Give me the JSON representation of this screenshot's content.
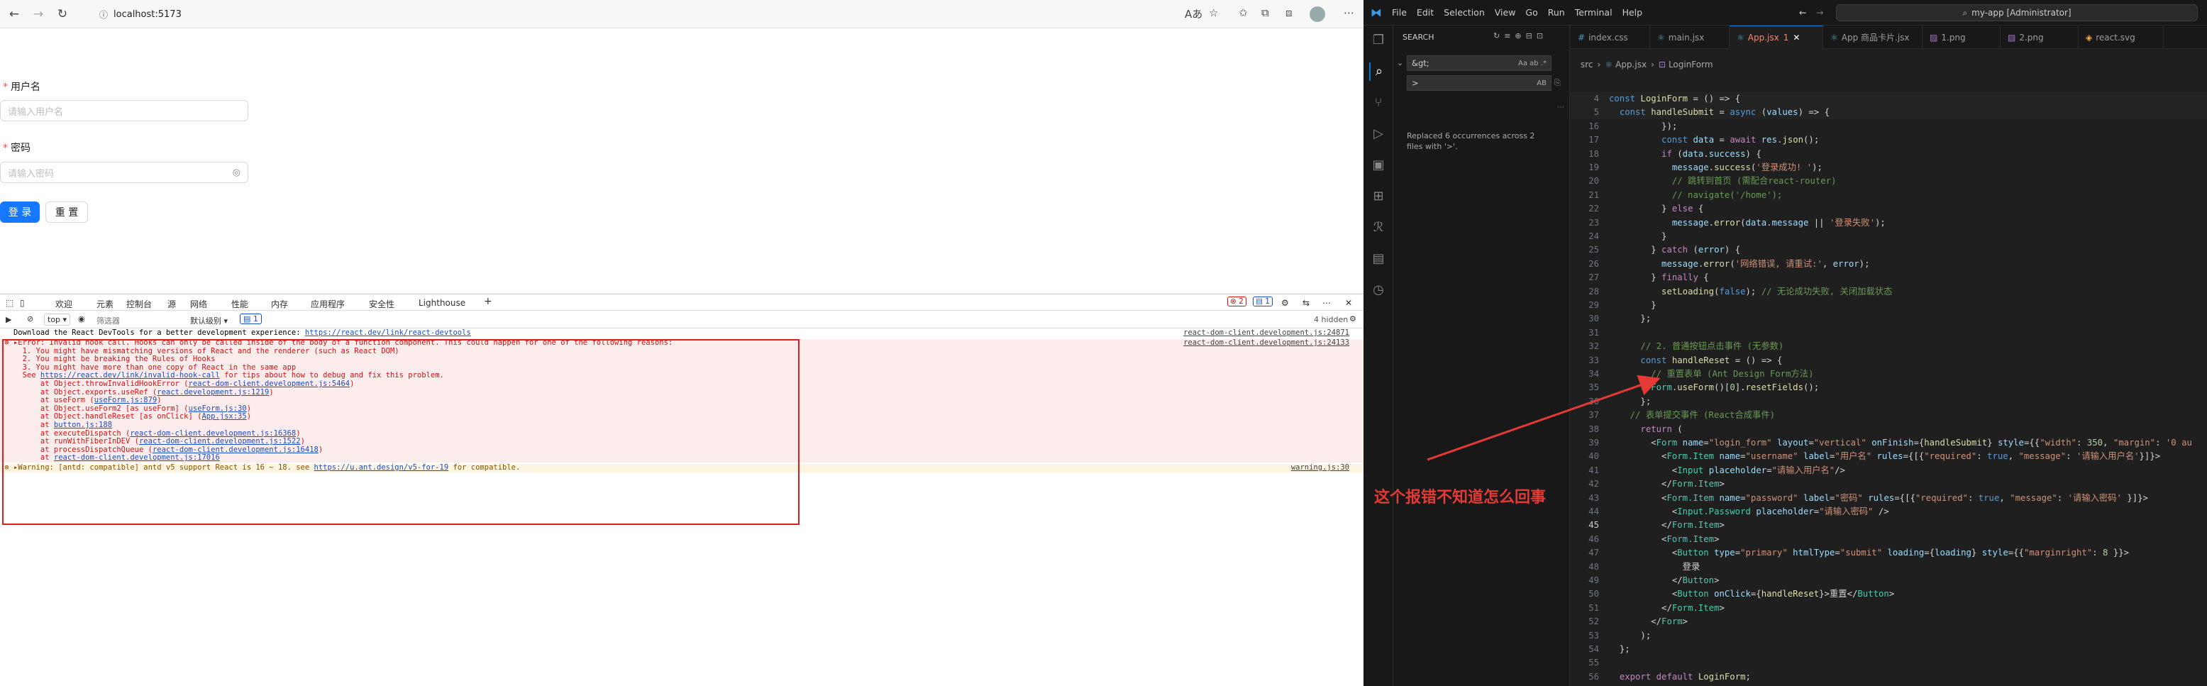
{
  "browser": {
    "url": "localhost:5173",
    "form": {
      "username_label": "用户名",
      "username_placeholder": "请输入用户名",
      "password_label": "密码",
      "password_placeholder": "请输入密码",
      "login_button": "登 录",
      "reset_button": "重 置"
    },
    "devtools": {
      "tabs": [
        "欢迎",
        "元素",
        "控制台",
        "源",
        "网络",
        "性能",
        "内存",
        "应用程序",
        "安全性",
        "Lighthouse"
      ],
      "active_tab": "控制台",
      "error_count": "2",
      "info_count": "1",
      "context": "top",
      "filter_placeholder": "筛选器",
      "level": "默认级别",
      "issue_count": "1",
      "hidden": "4 hidden",
      "console": [
        {
          "type": "info",
          "text": "Download the React DevTools for a better development experience: ",
          "link": "https://react.dev/link/react-devtools",
          "source": "react-dom-client.development.js:24871"
        },
        {
          "type": "error",
          "text": "▸Error: Invalid hook call. Hooks can only be called inside of the body of a function component. This could happen for one of the following reasons:",
          "source": "react-dom-client.development.js:24133"
        },
        {
          "type": "error-cont",
          "text": "1. You might have mismatching versions of React and the renderer (such as React DOM)"
        },
        {
          "type": "error-cont",
          "text": "2. You might be breaking the Rules of Hooks"
        },
        {
          "type": "error-cont",
          "text": "3. You might have more than one copy of React in the same app"
        },
        {
          "type": "error-cont",
          "text": "See ",
          "link": "https://react.dev/link/invalid-hook-call",
          "tail": " for tips about how to debug and fix this problem."
        },
        {
          "type": "stack",
          "text": "    at Object.throwInvalidHookError (",
          "link": "react-dom-client.development.js:5464",
          "tail": ")"
        },
        {
          "type": "stack",
          "text": "    at Object.exports.useRef (",
          "link": "react.development.js:1219",
          "tail": ")"
        },
        {
          "type": "stack",
          "text": "    at useForm (",
          "link": "useForm.js:879",
          "tail": ")"
        },
        {
          "type": "stack",
          "text": "    at Object.useForm2 [as useForm] (",
          "link": "useForm.js:30",
          "tail": ")"
        },
        {
          "type": "stack",
          "text": "    at Object.handleReset [as onClick] (",
          "link": "App.jsx:35",
          "tail": ")"
        },
        {
          "type": "stack",
          "text": "    at ",
          "link": "button.js:188",
          "tail": ""
        },
        {
          "type": "stack",
          "text": "    at executeDispatch (",
          "link": "react-dom-client.development.js:16368",
          "tail": ")"
        },
        {
          "type": "stack",
          "text": "    at runWithFiberInDEV (",
          "link": "react-dom-client.development.js:1522",
          "tail": ")"
        },
        {
          "type": "stack",
          "text": "    at processDispatchQueue (",
          "link": "react-dom-client.development.js:16418",
          "tail": ")"
        },
        {
          "type": "stack",
          "text": "    at ",
          "link": "react-dom-client.development.js:17016",
          "tail": ""
        },
        {
          "type": "warn",
          "text": "▸Warning: [antd: compatible] antd v5 support React is 16 ~ 18. see ",
          "link": "https://u.ant.design/v5-for-19",
          "tail": " for compatible.",
          "source": "warning.js:30"
        }
      ]
    }
  },
  "vscode": {
    "menus": [
      "File",
      "Edit",
      "Selection",
      "View",
      "Go",
      "Run",
      "Terminal",
      "Help"
    ],
    "command_center": "my-app [Administrator]",
    "search": {
      "title": "SEARCH",
      "find": "&gt;",
      "replace": ">",
      "result": "Replaced 6 occurrences across 2 files with '>'."
    },
    "tabs": [
      {
        "label": "index.css",
        "active": false
      },
      {
        "label": "main.jsx",
        "active": false
      },
      {
        "label": "App.jsx",
        "badge": "1",
        "active": true
      },
      {
        "label": "App 商品卡片.jsx",
        "active": false
      },
      {
        "label": "1.png",
        "active": false
      },
      {
        "label": "2.png",
        "active": false
      },
      {
        "label": "react.svg",
        "active": false
      }
    ],
    "breadcrumb": [
      "src",
      "App.jsx",
      "LoginForm"
    ],
    "code": [
      {
        "n": "4",
        "html": "<span class='kb'>const</span> <span class='f'>LoginForm</span> <span class='p'>= () =&gt; {</span>"
      },
      {
        "n": "5",
        "html": "  <span class='kb'>const</span> <span class='f'>handleSubmit</span> <span class='p'>=</span> <span class='kb'>async</span> <span class='p'>(</span><span class='v'>values</span><span class='p'>) =&gt; {</span>"
      },
      {
        "n": "16",
        "html": "          <span class='p'>});</span>"
      },
      {
        "n": "17",
        "html": "          <span class='kb'>const</span> <span class='v'>data</span> <span class='p'>=</span> <span class='k'>await</span> <span class='v'>res</span>.<span class='f'>json</span><span class='p'>();</span>"
      },
      {
        "n": "18",
        "html": "          <span class='k'>if</span> <span class='p'>(</span><span class='v'>data</span>.<span class='v'>success</span><span class='p'>) {</span>"
      },
      {
        "n": "19",
        "html": "            <span class='v'>message</span>.<span class='f'>success</span><span class='p'>(</span><span class='s'>'登录成功! '</span><span class='p'>);</span>"
      },
      {
        "n": "20",
        "html": "            <span class='c'>// 跳转到首页 (需配合react-router)</span>"
      },
      {
        "n": "21",
        "html": "            <span class='c'>// navigate('/home');</span>"
      },
      {
        "n": "22",
        "html": "          <span class='p'>}</span> <span class='k'>else</span> <span class='p'>{</span>"
      },
      {
        "n": "23",
        "html": "            <span class='v'>message</span>.<span class='f'>error</span><span class='p'>(</span><span class='v'>data</span>.<span class='v'>message</span> <span class='p'>||</span> <span class='s'>'登录失败'</span><span class='p'>);</span>"
      },
      {
        "n": "24",
        "html": "          <span class='p'>}</span>"
      },
      {
        "n": "25",
        "html": "        <span class='p'>}</span> <span class='k'>catch</span> <span class='p'>(</span><span class='v'>error</span><span class='p'>) {</span>"
      },
      {
        "n": "26",
        "html": "          <span class='v'>message</span>.<span class='f'>error</span><span class='p'>(</span><span class='s'>'网络错误, 请重试:'</span><span class='p'>,</span> <span class='v'>error</span><span class='p'>);</span>"
      },
      {
        "n": "27",
        "html": "        <span class='p'>}</span> <span class='k'>finally</span> <span class='p'>{</span>"
      },
      {
        "n": "28",
        "html": "          <span class='f'>setLoading</span><span class='p'>(</span><span class='kb'>false</span><span class='p'>);</span> <span class='c'>// 无论成功失败, 关闭加载状态</span>"
      },
      {
        "n": "29",
        "html": "        <span class='p'>}</span>"
      },
      {
        "n": "30",
        "html": "      <span class='p'>};</span>"
      },
      {
        "n": "31",
        "html": ""
      },
      {
        "n": "32",
        "html": "      <span class='c'>// 2. 普通按钮点击事件 (无参数)</span>"
      },
      {
        "n": "33",
        "html": "      <span class='kb'>const</span> <span class='f'>handleReset</span> <span class='p'>= () =&gt; {</span>"
      },
      {
        "n": "34",
        "html": "        <span class='c'>// 重置表单 (Ant Design Form方法)</span>"
      },
      {
        "n": "35",
        "html": "        <span class='t'>Form</span>.<span class='f'>useForm</span><span class='p'>()[</span><span class='n'>0</span><span class='p'>].</span><span class='f'>resetFields</span><span class='p'>();</span>"
      },
      {
        "n": "36",
        "html": "      <span class='p'>};</span>"
      },
      {
        "n": "37",
        "html": "    <span class='c'>// 表单提交事件 (React合成事件)</span>"
      },
      {
        "n": "38",
        "html": "      <span class='k'>return</span> <span class='p'>(</span>"
      },
      {
        "n": "39",
        "html": "        <span class='p'>&lt;</span><span class='t'>Form</span> <span class='v'>name</span><span class='p'>=</span><span class='s'>\"login_form\"</span> <span class='v'>layout</span><span class='p'>=</span><span class='s'>\"vertical\"</span> <span class='v'>onFinish</span><span class='p'>={</span><span class='f'>handleSubmit</span><span class='p'>}</span> <span class='v'>style</span><span class='p'>={{</span><span class='s'>\"width\"</span><span class='p'>:</span> <span class='n'>350</span><span class='p'>,</span> <span class='s'>\"margin\"</span><span class='p'>:</span> <span class='s'>'0 au</span>"
      },
      {
        "n": "40",
        "html": "          <span class='p'>&lt;</span><span class='t'>Form.Item</span> <span class='v'>name</span><span class='p'>=</span><span class='s'>\"username\"</span> <span class='v'>label</span><span class='p'>=</span><span class='s'>\"用户名\"</span> <span class='v'>rules</span><span class='p'>={[{</span><span class='s'>\"required\"</span><span class='p'>:</span> <span class='kb'>true</span><span class='p'>,</span> <span class='s'>\"message\"</span><span class='p'>:</span> <span class='s'>'请输入用户名'</span><span class='p'>}]}&gt;</span>"
      },
      {
        "n": "41",
        "html": "            <span class='p'>&lt;</span><span class='t'>Input</span> <span class='v'>placeholder</span><span class='p'>=</span><span class='s'>\"请输入用户名\"</span><span class='p'>/&gt;</span>"
      },
      {
        "n": "42",
        "html": "          <span class='p'>&lt;/</span><span class='t'>Form.Item</span><span class='p'>&gt;</span>"
      },
      {
        "n": "43",
        "html": "          <span class='p'>&lt;</span><span class='t'>Form.Item</span> <span class='v'>name</span><span class='p'>=</span><span class='s'>\"password\"</span> <span class='v'>label</span><span class='p'>=</span><span class='s'>\"密码\"</span> <span class='v'>rules</span><span class='p'>={[{</span><span class='s'>\"required\"</span><span class='p'>:</span> <span class='kb'>true</span><span class='p'>,</span> <span class='s'>\"message\"</span><span class='p'>:</span> <span class='s'>'请输入密码'</span> <span class='p'>}]}&gt;</span>"
      },
      {
        "n": "44",
        "html": "            <span class='p'>&lt;</span><span class='t'>Input.Password</span> <span class='v'>placeholder</span><span class='p'>=</span><span class='s'>\"请输入密码\"</span> <span class='p'>/&gt;</span>"
      },
      {
        "n": "45",
        "html": "          <span class='p'>&lt;/</span><span class='t'>Form.Item</span><span class='p'>&gt;</span>"
      },
      {
        "n": "46",
        "html": "          <span class='p'>&lt;</span><span class='t'>Form.Item</span><span class='p'>&gt;</span>"
      },
      {
        "n": "47",
        "html": "            <span class='p'>&lt;</span><span class='t'>Button</span> <span class='v'>type</span><span class='p'>=</span><span class='s'>\"primary\"</span> <span class='v'>htmlType</span><span class='p'>=</span><span class='s'>\"submit\"</span> <span class='v'>loading</span><span class='p'>={</span><span class='v'>loading</span><span class='p'>}</span> <span class='v'>style</span><span class='p'>={{</span><span class='s'>\"marginright\"</span><span class='p'>:</span> <span class='n'>8</span> <span class='p'>}}&gt;</span>"
      },
      {
        "n": "48",
        "html": "              <span class='p'>登录</span>"
      },
      {
        "n": "49",
        "html": "            <span class='p'>&lt;/</span><span class='t'>Button</span><span class='p'>&gt;</span>"
      },
      {
        "n": "50",
        "html": "            <span class='p'>&lt;</span><span class='t'>Button</span> <span class='v'>onClick</span><span class='p'>={</span><span class='f'>handleReset</span><span class='p'>}&gt;</span><span class='p'>重置</span><span class='p'>&lt;/</span><span class='t'>Button</span><span class='p'>&gt;</span>"
      },
      {
        "n": "51",
        "html": "          <span class='p'>&lt;/</span><span class='t'>Form.Item</span><span class='p'>&gt;</span>"
      },
      {
        "n": "52",
        "html": "        <span class='p'>&lt;/</span><span class='t'>Form</span><span class='p'>&gt;</span>"
      },
      {
        "n": "53",
        "html": "      <span class='p'>);</span>"
      },
      {
        "n": "54",
        "html": "  <span class='p'>};</span>"
      },
      {
        "n": "55",
        "html": ""
      },
      {
        "n": "56",
        "html": "  <span class='k'>export</span> <span class='k'>default</span> <span class='f'>LoginForm</span><span class='p'>;</span>"
      },
      {
        "n": "57",
        "html": ""
      }
    ]
  },
  "annotation": "这个报错不知道怎么回事",
  "colors": {
    "primary": "#1677ff",
    "error": "#e01e1e",
    "vscode_bg": "#1f1f1f"
  }
}
